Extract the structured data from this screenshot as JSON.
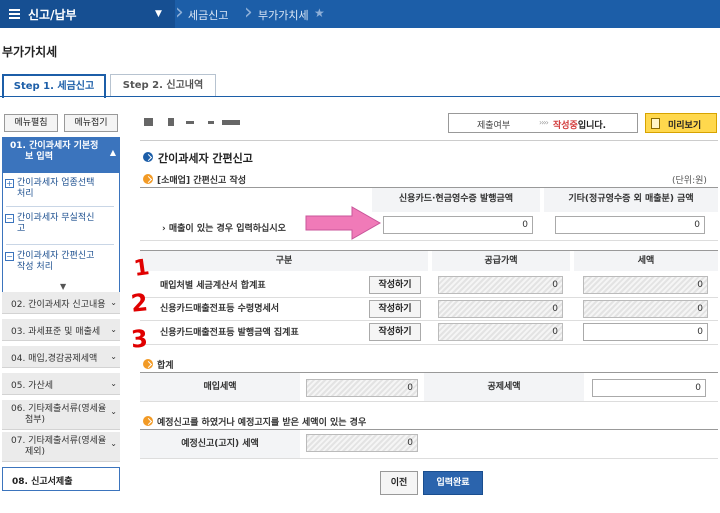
{
  "topnav": {
    "menu_label": "신고/납부",
    "crumbs": [
      "세금신고",
      "부가가치세"
    ]
  },
  "page_title": "부가가치세",
  "tabs": [
    {
      "label": "Step 1. 세금신고",
      "active": true
    },
    {
      "label": "Step 2. 신고내역",
      "active": false
    }
  ],
  "sidebar": {
    "expand_label": "메뉴펼침",
    "collapse_label": "메뉴접기",
    "active_item": "01. 간이과세자 기본정보 입력",
    "active_line1": "01. 간이과세자 기본정",
    "active_line2": "보 입력",
    "sub_items": [
      {
        "line1": "간이과세자 업종선택",
        "line2": "처리",
        "mark": "+"
      },
      {
        "line1": "간이과세자 무실적신",
        "line2": "고",
        "mark": "−"
      },
      {
        "line1": "간이과세자 간편신고",
        "line2": "작성 처리",
        "mark": "−"
      }
    ],
    "items": [
      {
        "label": "02. 간이과세자 신고내용"
      },
      {
        "label": "03. 과세표준 및 매출세"
      },
      {
        "label": "04. 매입,경감공제세액"
      },
      {
        "label": "05. 가산세"
      },
      {
        "line1": "06. 기타제출서류(영세율",
        "line2": "첨부)"
      },
      {
        "line1": "07. 기타제출서류(영세율",
        "line2": "제외)"
      }
    ],
    "last_item": "08. 신고서제출"
  },
  "status": {
    "label": "제출여부",
    "arrows": "››››",
    "value_red": "작성중",
    "value_rest": "입니다."
  },
  "preview_button": "미리보기",
  "section_title": "간이과세자 간편신고",
  "sales": {
    "title": "[소매업] 간편신고 작성",
    "unit": "(단위:원)",
    "col1": "신용카드·현금영수증 발행금액",
    "col2": "기타(정규영수증 외 매출분) 금액",
    "row_label": "› 매출이 있는 경우 입력하십시오",
    "value1": "0",
    "value2": "0"
  },
  "purchase": {
    "headers": [
      "구분",
      "공급가액",
      "세액"
    ],
    "button_label": "작성하기",
    "rows": [
      {
        "label": "매입처별 세금계산서 합계표",
        "supply": "0",
        "tax": "0"
      },
      {
        "label": "신용카드매출전표등 수령명세서",
        "supply": "0",
        "tax": "0"
      },
      {
        "label": "신용카드매출전표등 발행금액 집계표",
        "supply": "0",
        "tax": "0"
      }
    ]
  },
  "totals": {
    "title": "합계",
    "purchase_tax_label": "매입세액",
    "purchase_tax_value": "0",
    "deduction_label": "공제세액",
    "deduction_value": "0"
  },
  "prelim": {
    "title": "예정신고를 하였거나 예정고지를 받은 세액이 있는 경우",
    "label": "예정신고(고지) 세액",
    "value": "0"
  },
  "annotations": {
    "numbers": [
      "1",
      "2",
      "3"
    ],
    "arrow_color": "#f07ab8",
    "number_color": "#e00000"
  },
  "buttons": {
    "prev": "이전",
    "done": "입력완료"
  },
  "colors": {
    "brand_blue": "#1c5ea8",
    "active_side": "#3b74bd",
    "highlight_red": "#d23b3b",
    "preview_yellow": "#ffd84d"
  }
}
